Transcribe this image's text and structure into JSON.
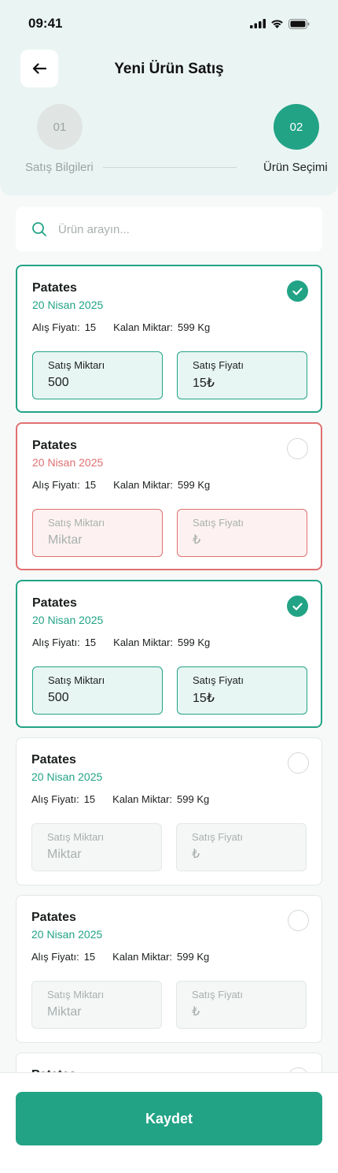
{
  "status_bar": {
    "time": "09:41"
  },
  "header": {
    "title": "Yeni Ürün Satış"
  },
  "stepper": {
    "steps": [
      {
        "number": "01",
        "label": "Satış Bilgileri"
      },
      {
        "number": "02",
        "label": "Ürün Seçimi"
      }
    ]
  },
  "search": {
    "placeholder": "Ürün arayın..."
  },
  "products": [
    {
      "name": "Patates",
      "date": "20 Nisan 2025",
      "purchase_label": "Alış Fiyatı:",
      "purchase_price": "15",
      "remaining_label": "Kalan Miktar:",
      "remaining": "599 Kg",
      "qty_label": "Satış Miktarı",
      "qty_value": "500",
      "qty_placeholder": "Miktar",
      "price_label": "Satış Fiyatı",
      "price_value": "15₺",
      "price_placeholder": "₺",
      "state": "selected"
    },
    {
      "name": "Patates",
      "date": "20 Nisan 2025",
      "purchase_label": "Alış Fiyatı:",
      "purchase_price": "15",
      "remaining_label": "Kalan Miktar:",
      "remaining": "599 Kg",
      "qty_label": "Satış Miktarı",
      "qty_value": "",
      "qty_placeholder": "Miktar",
      "price_label": "Satış Fiyatı",
      "price_value": "",
      "price_placeholder": "₺",
      "state": "error"
    },
    {
      "name": "Patates",
      "date": "20 Nisan 2025",
      "purchase_label": "Alış Fiyatı:",
      "purchase_price": "15",
      "remaining_label": "Kalan Miktar:",
      "remaining": "599 Kg",
      "qty_label": "Satış Miktarı",
      "qty_value": "500",
      "qty_placeholder": "Miktar",
      "price_label": "Satış Fiyatı",
      "price_value": "15₺",
      "price_placeholder": "₺",
      "state": "selected"
    },
    {
      "name": "Patates",
      "date": "20 Nisan 2025",
      "purchase_label": "Alış Fiyatı:",
      "purchase_price": "15",
      "remaining_label": "Kalan Miktar:",
      "remaining": "599 Kg",
      "qty_label": "Satış Miktarı",
      "qty_value": "",
      "qty_placeholder": "Miktar",
      "price_label": "Satış Fiyatı",
      "price_value": "",
      "price_placeholder": "₺",
      "state": "default"
    },
    {
      "name": "Patates",
      "date": "20 Nisan 2025",
      "purchase_label": "Alış Fiyatı:",
      "purchase_price": "15",
      "remaining_label": "Kalan Miktar:",
      "remaining": "599 Kg",
      "qty_label": "Satış Miktarı",
      "qty_value": "",
      "qty_placeholder": "Miktar",
      "price_label": "Satış Fiyatı",
      "price_value": "",
      "price_placeholder": "₺",
      "state": "default"
    },
    {
      "name": "Patates",
      "state": "default",
      "partial": true
    }
  ],
  "footer": {
    "save_label": "Kaydet"
  },
  "colors": {
    "accent": "#22a386",
    "error": "#e07070",
    "header_bg": "#eaf5f3"
  },
  "icons": {
    "back": "arrow-left-icon",
    "search": "search-icon",
    "check": "check-icon",
    "signal": "signal-icon",
    "wifi": "wifi-icon",
    "battery": "battery-icon"
  }
}
